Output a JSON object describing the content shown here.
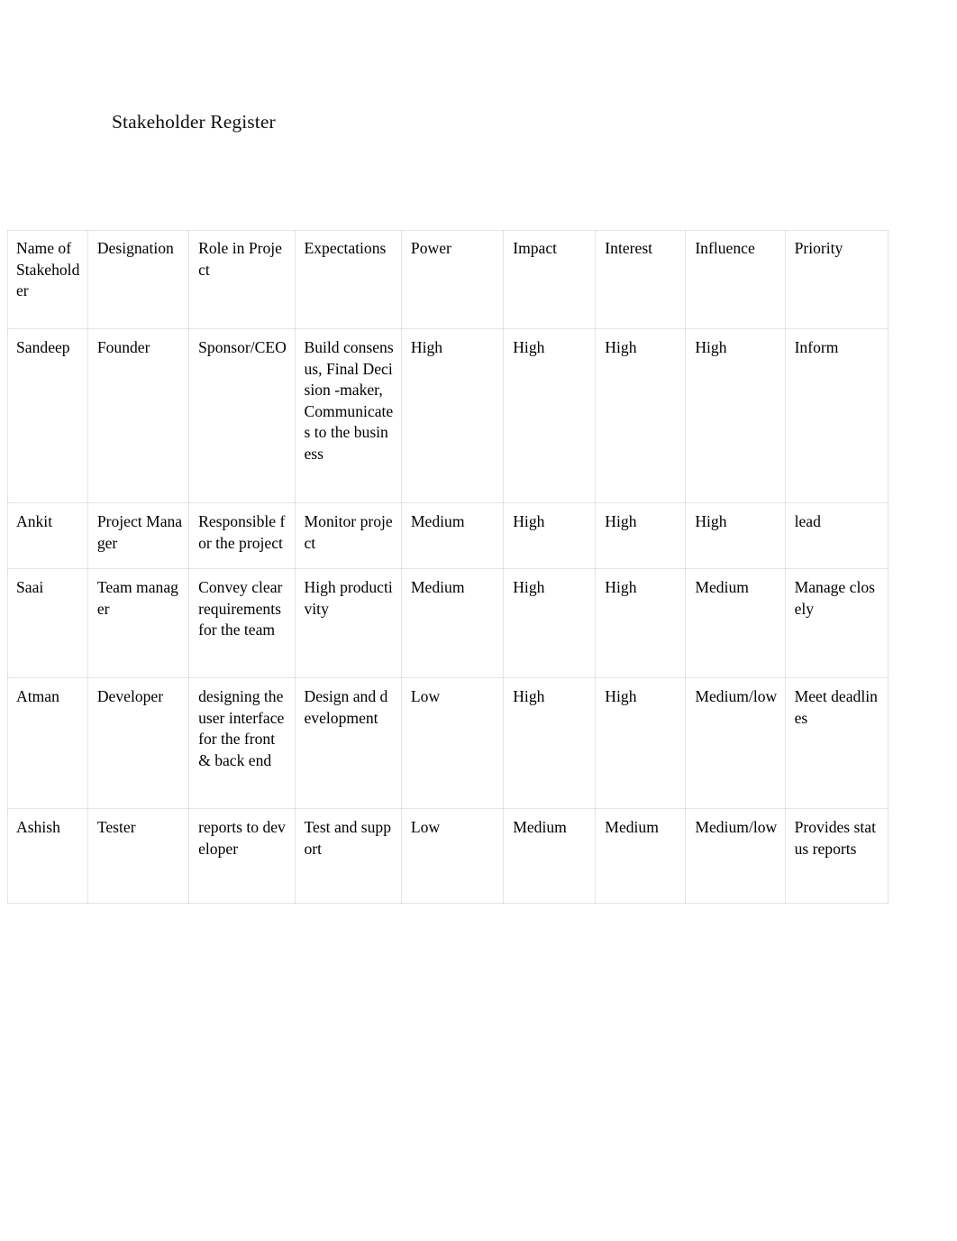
{
  "document": {
    "title": "Stakeholder Register"
  },
  "table": {
    "headers": [
      "Name of Stakeholder",
      "Designation",
      "Role in Project",
      "Expectations",
      "Power",
      "Impact",
      "Interest",
      "Influence",
      "Priority"
    ],
    "rows": [
      {
        "name": "Sandeep",
        "designation": "Founder",
        "role": "Sponsor/CEO",
        "expectations": "Build consensus, Final Decision -maker, Communicates to the business",
        "power": "High",
        "impact": "High",
        "interest": "High",
        "influence": "High",
        "priority": "Inform"
      },
      {
        "name": "Ankit",
        "designation": "Project Manager",
        "role": "Responsible for the project",
        "expectations": "Monitor project",
        "power": "Medium",
        "impact": "High",
        "interest": "High",
        "influence": "High",
        "priority": "lead"
      },
      {
        "name": "Saai",
        "designation": "Team manager",
        "role": "Convey clear requirements for the team",
        "expectations": "High productivity",
        "power": "Medium",
        "impact": "High",
        "interest": "High",
        "influence": "Medium",
        "priority": "Manage closely"
      },
      {
        "name": "Atman",
        "designation": "Developer",
        "role": "designing the user interface for the front & back end",
        "expectations": "Design and development",
        "power": "Low",
        "impact": "High",
        "interest": "High",
        "influence": "Medium/low",
        "priority": "Meet deadlines"
      },
      {
        "name": "Ashish",
        "designation": "Tester",
        "role": "reports to developer",
        "expectations": "Test and support",
        "power": "Low",
        "impact": "Medium",
        "interest": "Medium",
        "influence": "Medium/low",
        "priority": "Provides status reports"
      }
    ]
  },
  "colors": {
    "page_background": "#ffffff",
    "text": "#000000",
    "grid_line": "#aaaaaa"
  }
}
